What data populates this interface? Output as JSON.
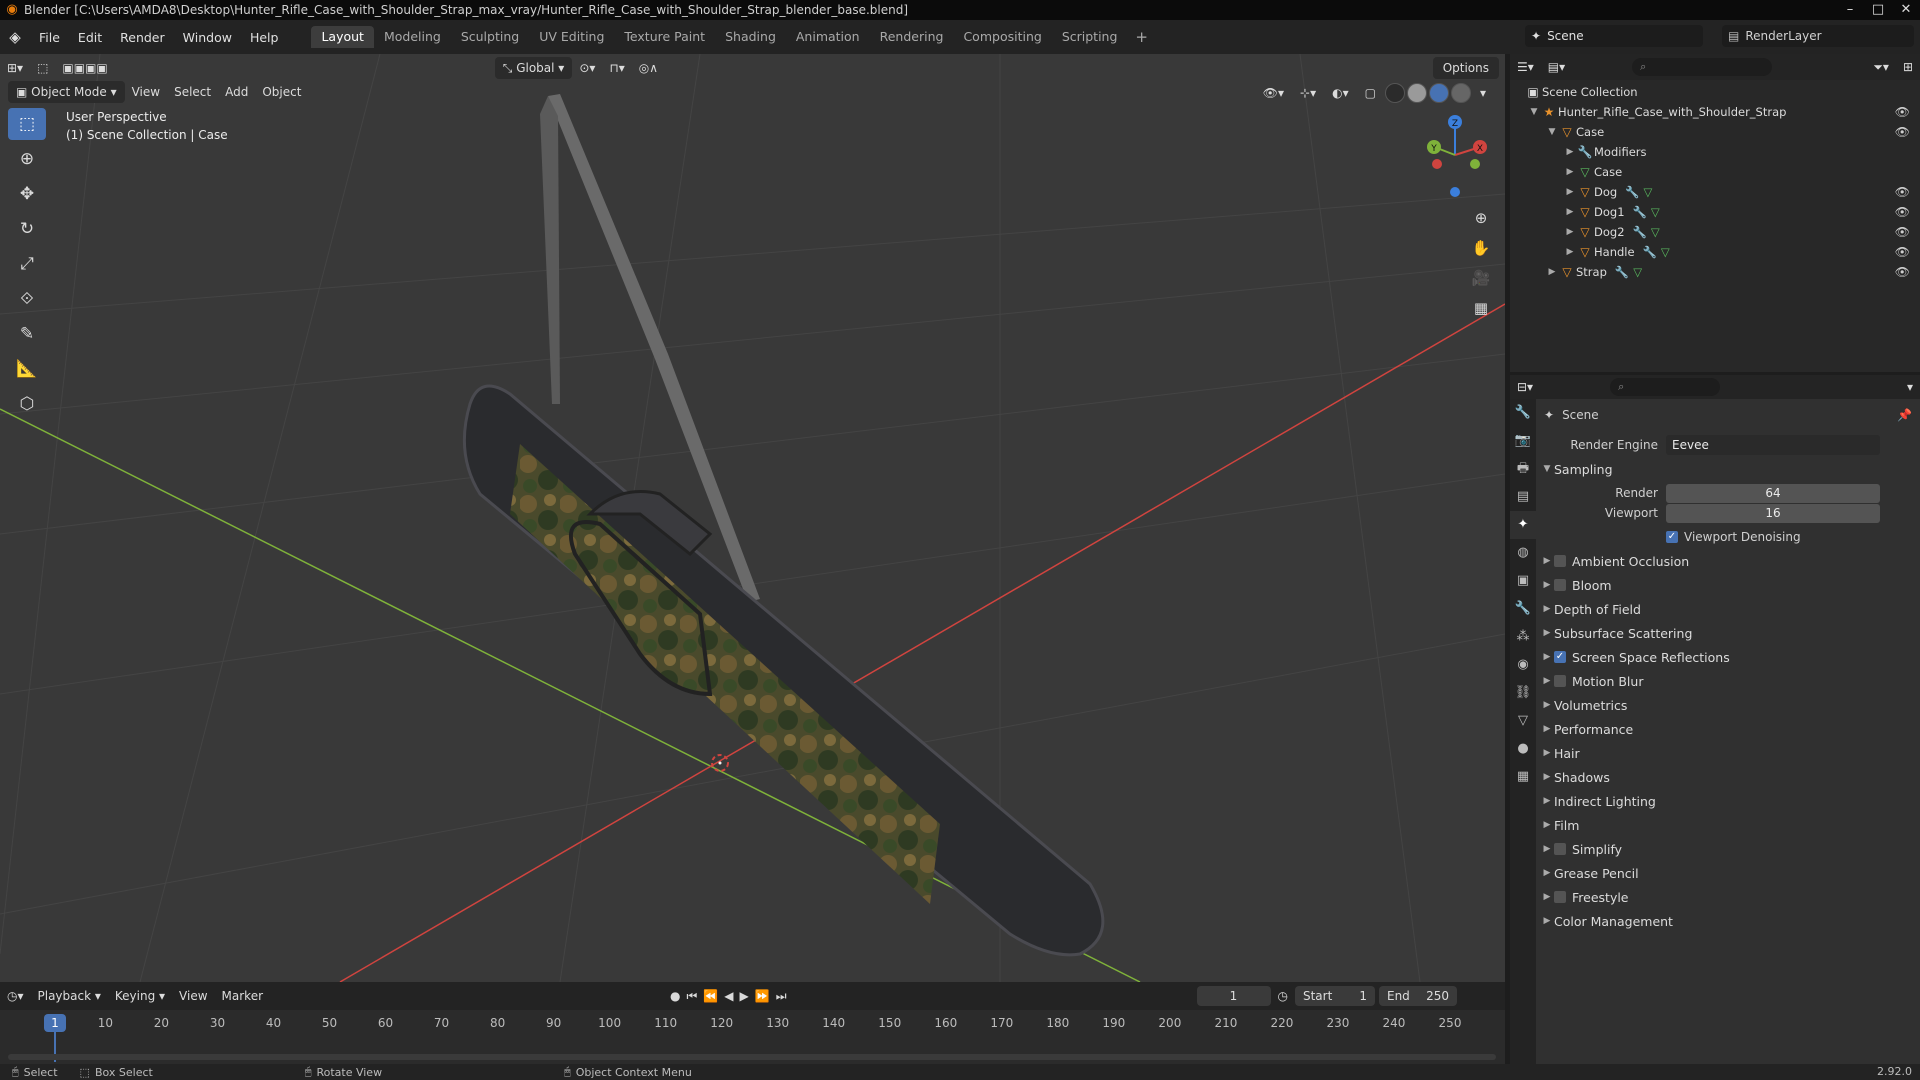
{
  "window": {
    "title": "Blender [C:\\Users\\AMDA8\\Desktop\\Hunter_Rifle_Case_with_Shoulder_Strap_max_vray/Hunter_Rifle_Case_with_Shoulder_Strap_blender_base.blend]",
    "controls": [
      "–",
      "□",
      "✕"
    ]
  },
  "menu": {
    "items": [
      "File",
      "Edit",
      "Render",
      "Window",
      "Help"
    ],
    "workspaces": [
      "Layout",
      "Modeling",
      "Sculpting",
      "UV Editing",
      "Texture Paint",
      "Shading",
      "Animation",
      "Rendering",
      "Compositing",
      "Scripting"
    ],
    "active_workspace": "Layout",
    "scene": "Scene",
    "view_layer": "RenderLayer"
  },
  "viewport": {
    "mode": "Object Mode",
    "menus": [
      "View",
      "Select",
      "Add",
      "Object"
    ],
    "orientation": "Global",
    "options": "Options",
    "info_line1": "User Perspective",
    "info_line2": "(1) Scene Collection | Case",
    "gizmo_axes": [
      "X",
      "Y",
      "Z"
    ]
  },
  "outliner": {
    "root": "Scene Collection",
    "items": [
      {
        "label": "Hunter_Rifle_Case_with_Shoulder_Strap",
        "indent": 1
      },
      {
        "label": "Case",
        "indent": 2
      },
      {
        "label": "Modifiers",
        "indent": 3
      },
      {
        "label": "Case",
        "indent": 3
      },
      {
        "label": "Dog",
        "indent": 3
      },
      {
        "label": "Dog1",
        "indent": 3
      },
      {
        "label": "Dog2",
        "indent": 3
      },
      {
        "label": "Handle",
        "indent": 3
      },
      {
        "label": "Strap",
        "indent": 2
      }
    ]
  },
  "properties": {
    "context": "Scene",
    "render_engine_label": "Render Engine",
    "render_engine": "Eevee",
    "sampling_label": "Sampling",
    "render_label": "Render",
    "render_samples": "64",
    "viewport_label": "Viewport",
    "viewport_samples": "16",
    "viewport_denoising": "Viewport Denoising",
    "panels": [
      {
        "label": "Ambient Occlusion",
        "checkbox": "off"
      },
      {
        "label": "Bloom",
        "checkbox": "off"
      },
      {
        "label": "Depth of Field",
        "checkbox": "none"
      },
      {
        "label": "Subsurface Scattering",
        "checkbox": "none"
      },
      {
        "label": "Screen Space Reflections",
        "checkbox": "on"
      },
      {
        "label": "Motion Blur",
        "checkbox": "off"
      },
      {
        "label": "Volumetrics",
        "checkbox": "none"
      },
      {
        "label": "Performance",
        "checkbox": "none"
      },
      {
        "label": "Hair",
        "checkbox": "none"
      },
      {
        "label": "Shadows",
        "checkbox": "none"
      },
      {
        "label": "Indirect Lighting",
        "checkbox": "none"
      },
      {
        "label": "Film",
        "checkbox": "none"
      },
      {
        "label": "Simplify",
        "checkbox": "off"
      },
      {
        "label": "Grease Pencil",
        "checkbox": "none"
      },
      {
        "label": "Freestyle",
        "checkbox": "off"
      },
      {
        "label": "Color Management",
        "checkbox": "none"
      }
    ]
  },
  "timeline": {
    "menus": [
      "Playback",
      "Keying",
      "View",
      "Marker"
    ],
    "current_frame": "1",
    "start_label": "Start",
    "start": "1",
    "end_label": "End",
    "end": "250",
    "ticks": [
      "1",
      "10",
      "20",
      "30",
      "40",
      "50",
      "60",
      "70",
      "80",
      "90",
      "100",
      "110",
      "120",
      "130",
      "140",
      "150",
      "160",
      "170",
      "180",
      "190",
      "200",
      "210",
      "220",
      "230",
      "240",
      "250"
    ]
  },
  "statusbar": {
    "select": "Select",
    "box_select": "Box Select",
    "rotate_view": "Rotate View",
    "context_menu": "Object Context Menu",
    "version": "2.92.0"
  },
  "colors": {
    "accent": "#4772b3",
    "x_axis": "#d0443f",
    "y_axis": "#7fb23a",
    "z_axis": "#3b7fdc"
  }
}
